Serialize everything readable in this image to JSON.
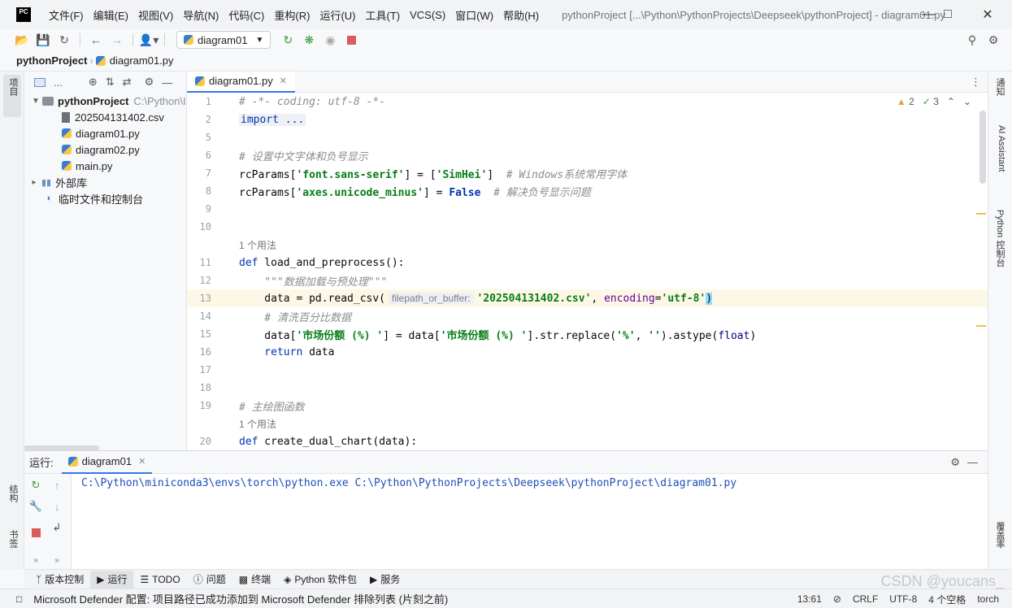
{
  "app": {
    "logo_text": "PC",
    "window_title": "pythonProject [...\\Python\\PythonProjects\\Deepseek\\pythonProject] - diagram01.py"
  },
  "menu": [
    "文件(F)",
    "编辑(E)",
    "视图(V)",
    "导航(N)",
    "代码(C)",
    "重构(R)",
    "运行(U)",
    "工具(T)",
    "VCS(S)",
    "窗口(W)",
    "帮助(H)"
  ],
  "toolbar": {
    "run_config": "diagram01"
  },
  "breadcrumb": {
    "project": "pythonProject",
    "file": "diagram01.py"
  },
  "left_strip": {
    "project": "项目",
    "structure": "结构",
    "bookmarks": "书签"
  },
  "right_strip": {
    "notifications": "通知",
    "ai_assistant": "AI Assistant",
    "python_console": "Python 控制台",
    "coverage": "覆盖率"
  },
  "project_panel": {
    "header": "...",
    "root": "pythonProject",
    "root_path": "C:\\Python\\I",
    "files": [
      "202504131402.csv",
      "diagram01.py",
      "diagram02.py",
      "main.py"
    ],
    "external_libs": "外部库",
    "scratches": "临时文件和控制台"
  },
  "editor": {
    "tab": "diagram01.py",
    "inspections": {
      "warnings": "2",
      "weak_warnings": "3"
    },
    "lines": [
      {
        "n": "1"
      },
      {
        "n": "2"
      },
      {
        "n": "5"
      },
      {
        "n": "6"
      },
      {
        "n": "7"
      },
      {
        "n": "8"
      },
      {
        "n": "9"
      },
      {
        "n": "10"
      },
      {
        "n": "11"
      },
      {
        "n": "12"
      },
      {
        "n": "13"
      },
      {
        "n": "14"
      },
      {
        "n": "15"
      },
      {
        "n": "16"
      },
      {
        "n": "17"
      },
      {
        "n": "18"
      },
      {
        "n": "19"
      },
      {
        "n": "20"
      }
    ],
    "code": {
      "l1": "# -*- coding: utf-8 -*-",
      "l2": "import ...",
      "l6": "# 设置中文字体和负号显示",
      "l7_a": "rcParams[",
      "l7_b": "'font.sans-serif'",
      "l7_c": "] = [",
      "l7_d": "'SimHei'",
      "l7_e": "]  ",
      "l7_f": "# Windows系统常用字体",
      "l8_a": "rcParams[",
      "l8_b": "'axes.unicode_minus'",
      "l8_c": "] = ",
      "l8_d": "False",
      "l8_e": "  ",
      "l8_f": "# 解决负号显示问题",
      "usage1": "1 个用法",
      "l11_kw": "def",
      "l11_rest": " load_and_preprocess():",
      "l12": "    \"\"\"数据加载与预处理\"\"\"",
      "l13_a": "    data = pd.read_csv(",
      "l13_hint": "filepath_or_buffer:",
      "l13_b": "'202504131402.csv'",
      "l13_c": ", ",
      "l13_d": "encoding",
      "l13_e": "=",
      "l13_f": "'utf-8'",
      "l13_g": ")",
      "l14": "    # 清洗百分比数据",
      "l15_a": "    data[",
      "l15_b": "'市场份额 (%) '",
      "l15_c": "] = data[",
      "l15_d": "'市场份额 (%) '",
      "l15_e": "].str.replace(",
      "l15_f": "'%'",
      "l15_g": ", ",
      "l15_h": "''",
      "l15_i": ").astype(",
      "l15_j": "float",
      "l15_k": ")",
      "l16_kw": "    return",
      "l16_rest": " data",
      "l19": "# 主绘图函数",
      "usage2": "1 个用法",
      "l20_kw": "def",
      "l20_rest": " create_dual_chart(data):"
    }
  },
  "run_panel": {
    "label": "运行:",
    "tab": "diagram01",
    "console": "C:\\Python\\miniconda3\\envs\\torch\\python.exe C:\\Python\\PythonProjects\\Deepseek\\pythonProject\\diagram01.py"
  },
  "bottom_tools": [
    "版本控制",
    "运行",
    "TODO",
    "问题",
    "终端",
    "Python 软件包",
    "服务"
  ],
  "status": {
    "message": "Microsoft Defender 配置: 项目路径已成功添加到 Microsoft Defender 排除列表 (片刻之前)",
    "position": "13:61",
    "line_sep": "CRLF",
    "encoding": "UTF-8",
    "indent": "4 个空格",
    "interpreter": "torch"
  },
  "watermark": "CSDN @youcans_",
  "colors": {
    "accent": "#3574f0",
    "keyword": "#0033b3",
    "string": "#067d17",
    "comment": "#8c8c8c",
    "warning": "#e8a33d"
  }
}
